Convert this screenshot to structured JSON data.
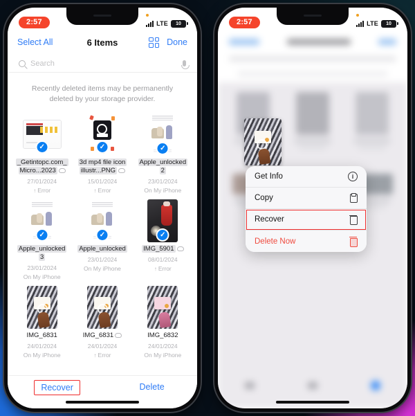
{
  "status_bar": {
    "time": "2:57",
    "carrier": "LTE",
    "battery_level": "10",
    "signal_icon": "cellular-bars-icon",
    "recording_dot": "recording-indicator-icon"
  },
  "left_phone": {
    "nav": {
      "select_all": "Select All",
      "title": "6 Items",
      "grid_view_icon": "grid-view-icon",
      "done": "Done"
    },
    "search": {
      "placeholder": "Search",
      "search_icon": "search-icon",
      "mic_icon": "microphone-icon"
    },
    "notice": "Recently deleted items may be permanently deleted by your storage provider.",
    "files": [
      {
        "name_line1": "_Getintopc.com_",
        "name_line2": "Micro...2023",
        "date": "27/01/2024",
        "location": "Error",
        "location_type": "error",
        "has_cloud": true,
        "selected": true,
        "thumb": "document-screenshot-thumbnail"
      },
      {
        "name_line1": "3d mp4 file icon",
        "name_line2": "illustr...PNG",
        "date": "15/01/2024",
        "location": "Error",
        "location_type": "error",
        "has_cloud": true,
        "selected": true,
        "thumb": "3d-file-icon-thumbnail"
      },
      {
        "name_line1": "Apple_unlocked",
        "name_line2": "2",
        "date": "23/01/2024",
        "location": "On My iPhone",
        "location_type": "normal",
        "has_cloud": false,
        "selected": true,
        "thumb": "product-photo-thumbnail"
      },
      {
        "name_line1": "Apple_unlocked",
        "name_line2": "3",
        "date": "23/01/2024",
        "location": "On My iPhone",
        "location_type": "normal",
        "has_cloud": false,
        "selected": true,
        "thumb": "product-photo-thumbnail"
      },
      {
        "name_line1": "Apple_unlocked",
        "name_line2": "",
        "date": "23/01/2024",
        "location": "On My iPhone",
        "location_type": "normal",
        "has_cloud": false,
        "selected": true,
        "thumb": "product-photo-thumbnail"
      },
      {
        "name_line1": "IMG_5901",
        "name_line2": "",
        "date": "08/01/2024",
        "location": "Error",
        "location_type": "error",
        "has_cloud": true,
        "selected": true,
        "thumb": "red-cup-photo-thumbnail"
      },
      {
        "name_line1": "IMG_6831",
        "name_line2": "",
        "date": "24/01/2024",
        "location": "On My iPhone",
        "location_type": "normal",
        "has_cloud": false,
        "selected": false,
        "thumb": "fabric-photo-thumbnail"
      },
      {
        "name_line1": "IMG_6831",
        "name_line2": "",
        "date": "24/01/2024",
        "location": "Error",
        "location_type": "error",
        "has_cloud": true,
        "selected": false,
        "thumb": "fabric-photo-thumbnail"
      },
      {
        "name_line1": "IMG_6832",
        "name_line2": "",
        "date": "24/01/2024",
        "location": "On My iPhone",
        "location_type": "normal",
        "has_cloud": false,
        "selected": false,
        "thumb": "fabric-pink-photo-thumbnail"
      }
    ],
    "toolbar": {
      "recover": "Recover",
      "delete": "Delete"
    }
  },
  "right_phone": {
    "context_menu": [
      {
        "label": "Get Info",
        "icon": "info-circle-icon",
        "highlighted": false,
        "danger": false
      },
      {
        "label": "Copy",
        "icon": "copy-icon",
        "highlighted": false,
        "danger": false
      },
      {
        "label": "Recover",
        "icon": "recover-trash-icon",
        "highlighted": true,
        "danger": false
      },
      {
        "label": "Delete Now",
        "icon": "trash-icon",
        "highlighted": false,
        "danger": true
      }
    ]
  },
  "highlight_color": "#ee2b2b",
  "accent_color": "#2f7cf6"
}
